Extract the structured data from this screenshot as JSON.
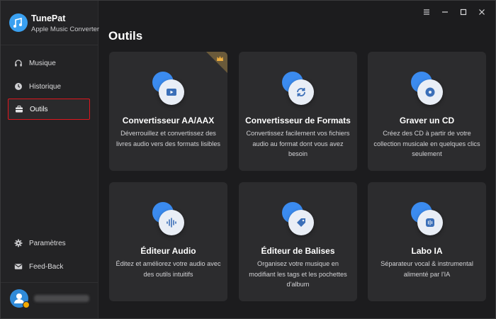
{
  "brand": {
    "name": "TunePat",
    "subtitle": "Apple Music Converter"
  },
  "sidebar": {
    "items": [
      {
        "label": "Musique",
        "icon": "headphones-icon"
      },
      {
        "label": "Historique",
        "icon": "clock-icon"
      },
      {
        "label": "Outils",
        "icon": "toolbox-icon",
        "active": true
      }
    ],
    "bottom_items": [
      {
        "label": "Paramètres",
        "icon": "gear-icon"
      },
      {
        "label": "Feed-Back",
        "icon": "mail-icon"
      }
    ]
  },
  "main": {
    "title": "Outils",
    "cards": [
      {
        "title": "Convertisseur AA/AAX",
        "desc": "Déverrouillez et convertissez des livres audio vers des formats lisibles",
        "icon": "play-video-icon",
        "premium": true
      },
      {
        "title": "Convertisseur de Formats",
        "desc": "Convertissez facilement vos fichiers audio au format dont vous avez besoin",
        "icon": "refresh-icon"
      },
      {
        "title": "Graver un CD",
        "desc": "Créez des CD à partir de votre collection musicale en quelques clics seulement",
        "icon": "disc-icon"
      },
      {
        "title": "Éditeur Audio",
        "desc": "Éditez et améliorez votre audio avec des outils intuitifs",
        "icon": "waveform-icon"
      },
      {
        "title": "Éditeur de Balises",
        "desc": "Organisez votre musique en modifiant les tags et les pochettes d'album",
        "icon": "tag-icon"
      },
      {
        "title": "Labo IA",
        "desc": "Séparateur vocal & instrumental alimenté par l'IA",
        "icon": "ai-separator-icon"
      }
    ]
  },
  "colors": {
    "accent": "#3b8bef",
    "highlight_border": "#e0161e",
    "card_bg": "#2c2c2e",
    "sidebar_bg": "#232325",
    "app_bg": "#1c1c1e"
  }
}
